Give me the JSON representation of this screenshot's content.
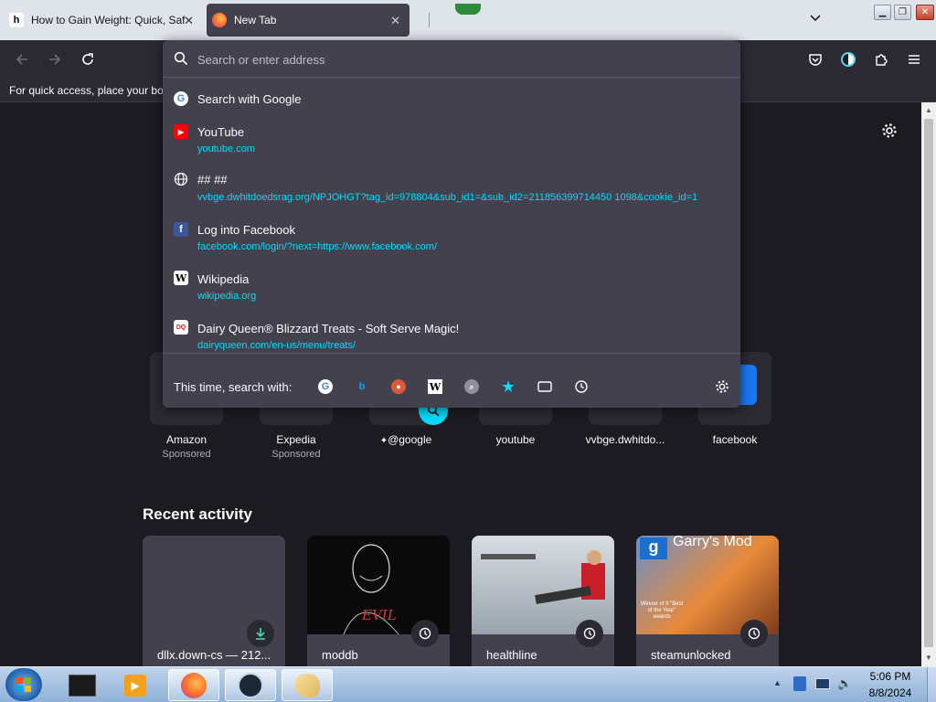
{
  "colors": {
    "tab_active_bg": "#42414d",
    "toolbar_bg": "#2b2a33",
    "page_bg": "#1c1b22",
    "accent_cyan": "#00ddff",
    "url_text": "#00ddff"
  },
  "tabs": [
    {
      "title": "How to Gain Weight: Quick, Saf",
      "favicon": "wikihow-icon",
      "active": false
    },
    {
      "title": "New Tab",
      "favicon": "firefox-icon",
      "active": true
    }
  ],
  "window_controls": [
    "minimize-icon",
    "restore-icon",
    "close-icon"
  ],
  "bookmarks_bar": {
    "text": "For quick access, place your boo"
  },
  "urlbar": {
    "placeholder": "Search or enter address",
    "suggestions": [
      {
        "icon": "google-icon",
        "title": "Search with Google",
        "url": ""
      },
      {
        "icon": "youtube-icon",
        "title": "YouTube",
        "url": "youtube.com"
      },
      {
        "icon": "globe-icon",
        "title": "## ##",
        "url": "vvbge.dwhitdoedsrag.org/NPJOHGT?tag_id=978804&sub_id1=&sub_id2=211856399714450 1098&cookie_id=1"
      },
      {
        "icon": "facebook-icon",
        "title": "Log into Facebook",
        "url": "facebook.com/login/?next=https://www.facebook.com/"
      },
      {
        "icon": "wikipedia-icon",
        "title": "Wikipedia",
        "url": "wikipedia.org"
      },
      {
        "icon": "dairy-queen-icon",
        "title": "Dairy Queen® Blizzard Treats - Soft Serve Magic!",
        "url": "dairyqueen.com/en-us/menu/treats/"
      }
    ],
    "oneoff_label": "This time, search with:",
    "oneoff_engines": [
      "google-icon",
      "bing-icon",
      "duckduckgo-icon",
      "wikipedia-icon",
      "search-engine-icon",
      "bookmarks-star-icon",
      "tabs-icon",
      "history-icon"
    ]
  },
  "top_sites": [
    {
      "label": "Amazon",
      "sub": "Sponsored"
    },
    {
      "label": "Expedia",
      "sub": "Sponsored"
    },
    {
      "label": "@google",
      "sub": ""
    },
    {
      "label": "youtube",
      "sub": ""
    },
    {
      "label": "vvbge.dwhitdo...",
      "sub": ""
    },
    {
      "label": "facebook",
      "sub": ""
    }
  ],
  "recent_activity": {
    "title": "Recent activity",
    "cards": [
      {
        "caption": "dllx.down-cs — 212...",
        "badge": "download-icon"
      },
      {
        "caption": "moddb",
        "badge": "clock-icon",
        "image_text": "EVIL"
      },
      {
        "caption": "healthline",
        "badge": "clock-icon"
      },
      {
        "caption": "steamunlocked",
        "badge": "clock-icon",
        "image_text": "Garry's Mod",
        "image_text2": "Winner of 9 \"Best of the Year\" awards"
      }
    ]
  },
  "taskbar": {
    "apps": [
      "start-orb-icon",
      "black-box-app-icon",
      "media-player-icon",
      "firefox-icon",
      "steam-icon",
      "paint-icon"
    ],
    "time": "5:06 PM",
    "date": "8/8/2024"
  }
}
